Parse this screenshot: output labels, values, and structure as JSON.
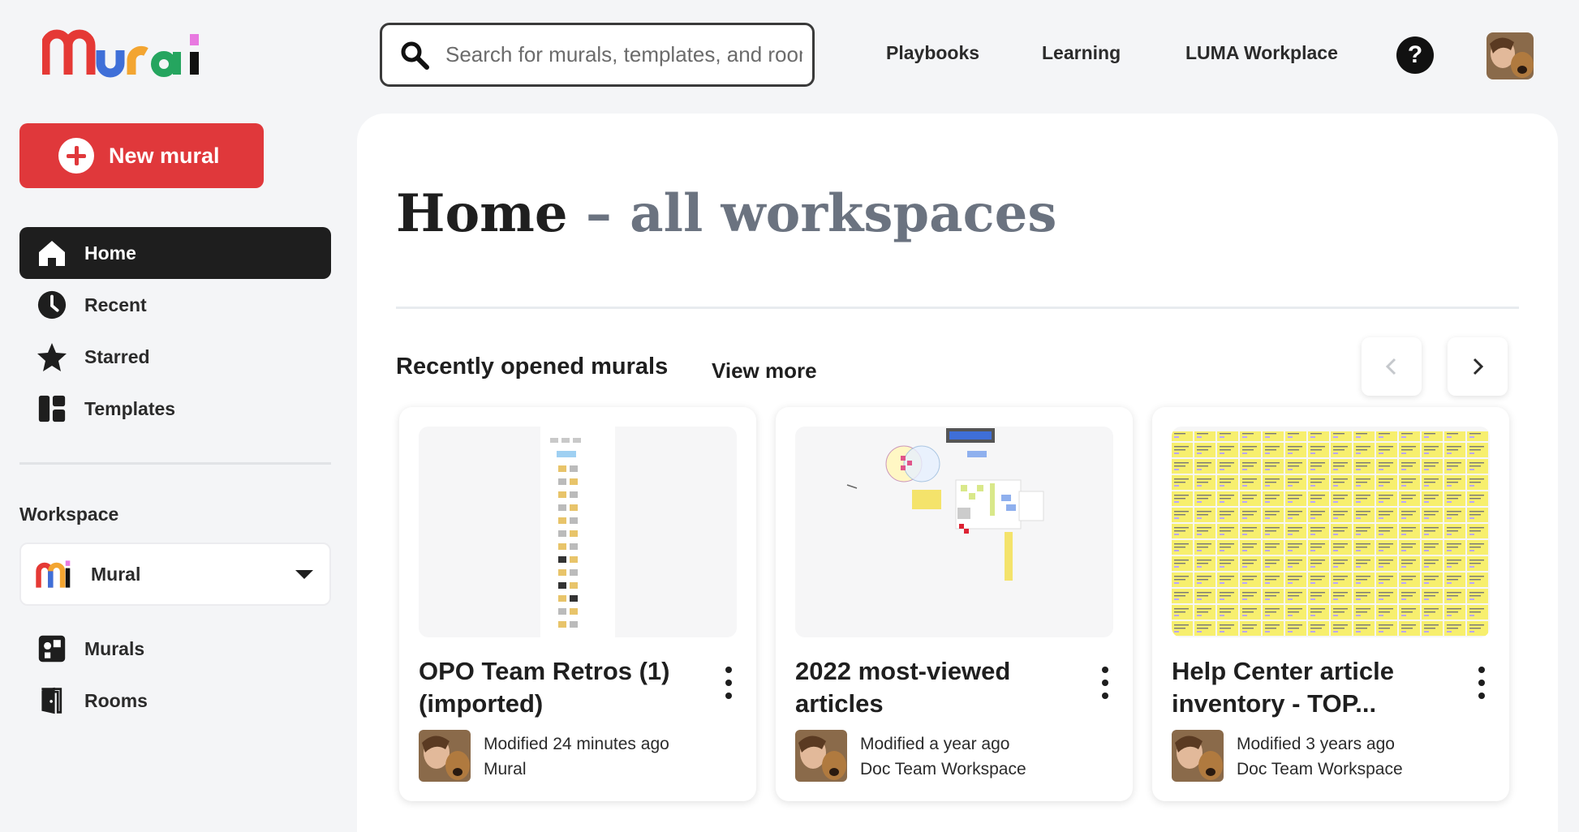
{
  "brand": {
    "logo_text": "Mural",
    "accent": "#e0383b"
  },
  "search": {
    "placeholder": "Search for murals, templates, and rooms"
  },
  "topnav": [
    {
      "label": "Playbooks"
    },
    {
      "label": "Learning"
    },
    {
      "label": "LUMA Workplace"
    }
  ],
  "help": {
    "label": "?"
  },
  "sidebar": {
    "new_mural": "New mural",
    "items": [
      {
        "label": "Home",
        "icon": "home-icon",
        "active": true
      },
      {
        "label": "Recent",
        "icon": "clock-icon"
      },
      {
        "label": "Starred",
        "icon": "star-icon"
      },
      {
        "label": "Templates",
        "icon": "templates-icon"
      }
    ],
    "workspace_label": "Workspace",
    "workspace_name": "Mural",
    "workspace_items": [
      {
        "label": "Murals",
        "icon": "murals-icon"
      },
      {
        "label": "Rooms",
        "icon": "rooms-icon"
      }
    ]
  },
  "main": {
    "title": "Home",
    "subtitle": "– all workspaces",
    "section_title": "Recently opened murals",
    "view_more": "View more",
    "cards": [
      {
        "title_line1": "OPO Team Retros (1)",
        "title_line2": "(imported)",
        "modified": "Modified 24 minutes ago",
        "workspace": "Mural"
      },
      {
        "title_line1": "2022 most-viewed",
        "title_line2": "articles",
        "modified": "Modified a year ago",
        "workspace": "Doc Team Workspace"
      },
      {
        "title_line1": "Help Center article",
        "title_line2": "inventory - TOP...",
        "modified": "Modified 3 years ago",
        "workspace": "Doc Team Workspace"
      }
    ]
  }
}
